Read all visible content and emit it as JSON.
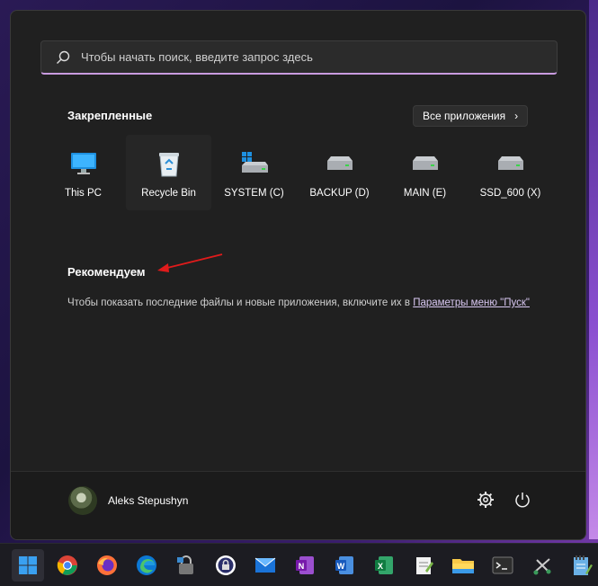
{
  "search": {
    "placeholder": "Чтобы начать поиск, введите запрос здесь"
  },
  "pinned": {
    "title": "Закрепленные",
    "all_apps_label": "Все приложения",
    "apps": [
      {
        "label": "This PC",
        "icon": "monitor-icon"
      },
      {
        "label": "Recycle Bin",
        "icon": "recycle-bin-icon"
      },
      {
        "label": "SYSTEM (C)",
        "icon": "windows-drive-icon"
      },
      {
        "label": "BACKUP (D)",
        "icon": "drive-icon"
      },
      {
        "label": "MAIN (E)",
        "icon": "drive-icon"
      },
      {
        "label": "SSD_600 (X)",
        "icon": "drive-icon"
      }
    ]
  },
  "recommended": {
    "title": "Рекомендуем",
    "text": "Чтобы показать последние файлы и новые приложения, включите их в ",
    "link": "Параметры меню \"Пуск\""
  },
  "user": {
    "name": "Aleks Stepushyn"
  },
  "taskbar": {
    "items": [
      "start-icon",
      "chrome-icon",
      "firefox-icon",
      "edge-icon",
      "lock-app-icon",
      "keepass-icon",
      "mail-icon",
      "onenote-icon",
      "word-icon",
      "excel-icon",
      "notepad-icon",
      "file-explorer-icon",
      "terminal-icon",
      "snipping-icon",
      "notepadpp-icon"
    ]
  },
  "colors": {
    "accent": "#c99be0",
    "menu_bg": "#202020",
    "annotation_arrow": "#e01b1b"
  }
}
